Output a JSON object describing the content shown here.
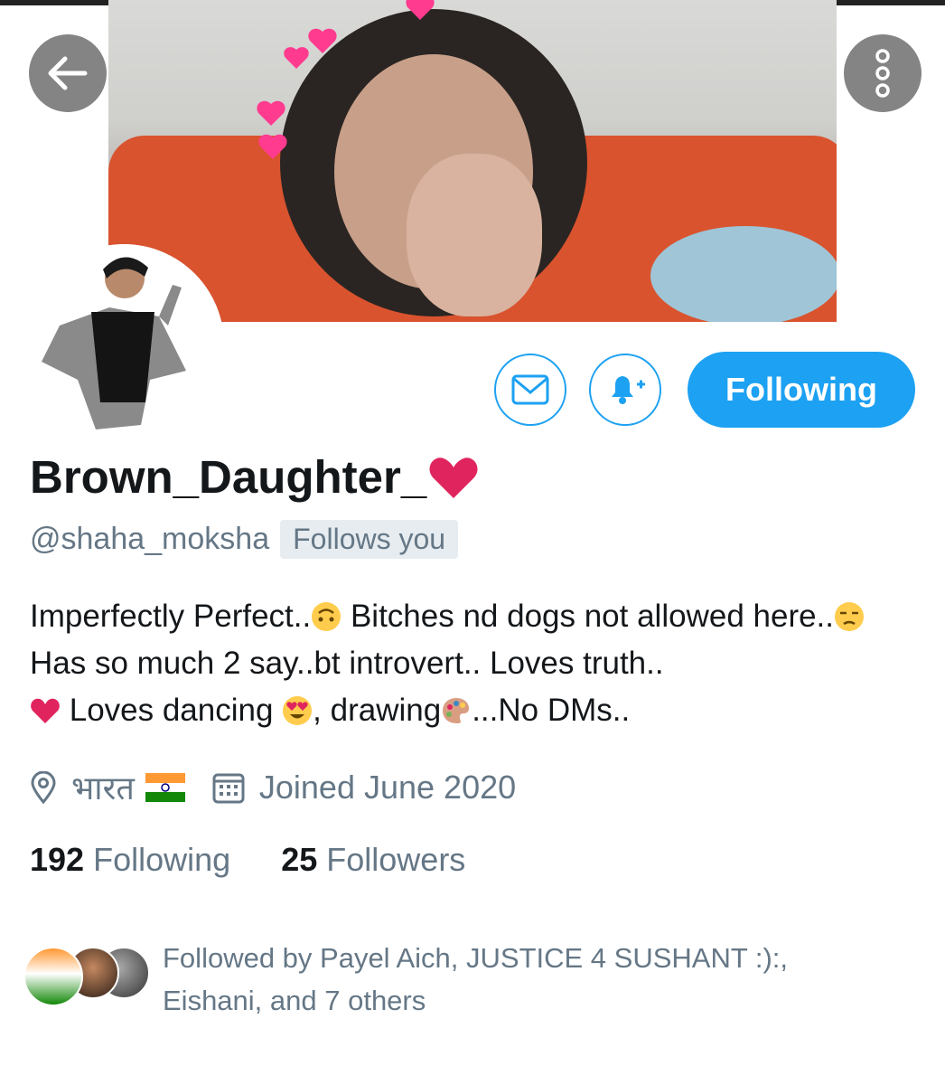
{
  "colors": {
    "accent": "#1da1f2",
    "secondary_text": "#657786",
    "heart": "#e0245e"
  },
  "header": {
    "back_icon": "arrow-left-icon",
    "more_icon": "vertical-ellipsis-icon"
  },
  "actions": {
    "message_icon": "mail-icon",
    "notify_icon": "bell-plus-icon",
    "follow_label": "Following"
  },
  "profile": {
    "display_name": "Brown_Daughter_",
    "handle": "@shaha_moksha",
    "follows_you": "Follows you",
    "bio_parts": {
      "p1": "Imperfectly Perfect..",
      "p2": " Bitches nd dogs not allowed here..",
      "p3": " Has so much 2 say..bt introvert.. Loves truth..",
      "p4": " Loves dancing ",
      "p5": ", drawing",
      "p6": "...No DMs.."
    },
    "location": "भारत",
    "joined": "Joined June 2020"
  },
  "stats": {
    "following_count": "192",
    "following_label": "Following",
    "followers_count": "25",
    "followers_label": "Followers"
  },
  "followed_by": "Followed by Payel Aich, JUSTICE 4 SUSHANT :):, Eishani, and 7 others"
}
